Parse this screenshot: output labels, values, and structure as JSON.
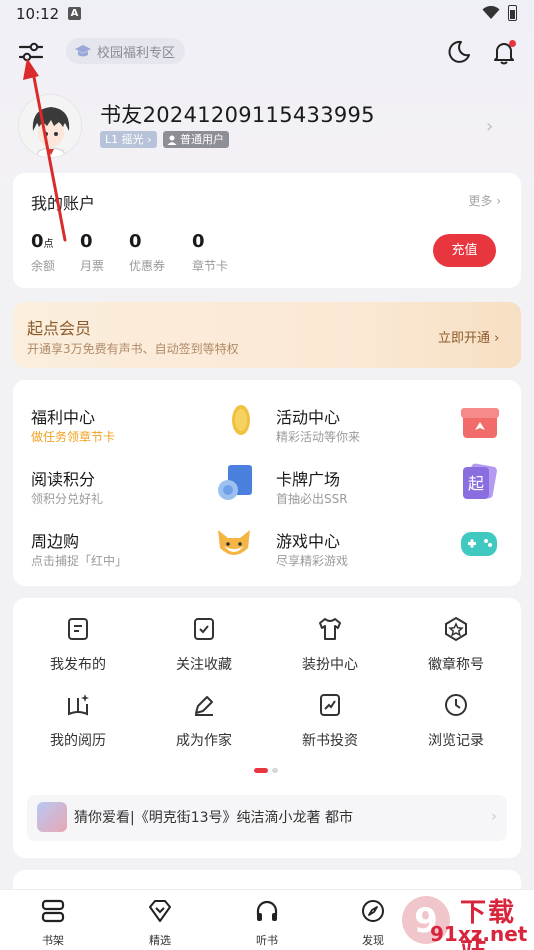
{
  "status_bar": {
    "time": "10:12",
    "notification_letter": "A"
  },
  "top_bar": {
    "campus_label": "校园福利专区",
    "filter_icon": "sliders-icon",
    "moon_icon": "moon-icon",
    "bell_icon": "bell-icon"
  },
  "profile": {
    "username": "书友20241209115433995",
    "level": "L1 摇光",
    "user_type": "普通用户"
  },
  "account": {
    "title": "我的账户",
    "more": "更多",
    "items": [
      {
        "value": "0",
        "unit": "点",
        "label": "余额"
      },
      {
        "value": "0",
        "unit": "",
        "label": "月票"
      },
      {
        "value": "0",
        "unit": "",
        "label": "优惠券"
      },
      {
        "value": "0",
        "unit": "",
        "label": "章节卡"
      }
    ],
    "recharge": "充值"
  },
  "vip": {
    "title": "起点会员",
    "desc": "开通享3万免费有声书、自动签到等特权",
    "open": "立即开通"
  },
  "services": [
    {
      "title": "福利中心",
      "sub": "做任务领章节卡",
      "icon": "gold-coin-icon",
      "sub_color": "#f0a020"
    },
    {
      "title": "活动中心",
      "sub": "精彩活动等你来",
      "icon": "gift-box-icon",
      "sub_color": "#9a9a9a"
    },
    {
      "title": "阅读积分",
      "sub": "领积分兑好礼",
      "icon": "points-book-icon",
      "sub_color": "#9a9a9a"
    },
    {
      "title": "卡牌广场",
      "sub": "首抽必出SSR",
      "icon": "card-icon",
      "sub_color": "#9a9a9a"
    },
    {
      "title": "周边购",
      "sub": "点击捕捉「红中」",
      "icon": "fox-mascot-icon",
      "sub_color": "#9a9a9a"
    },
    {
      "title": "游戏中心",
      "sub": "尽享精彩游戏",
      "icon": "gamepad-icon",
      "sub_color": "#9a9a9a"
    }
  ],
  "card_glyph": "起",
  "tools": [
    {
      "label": "我发布的",
      "icon": "document-icon"
    },
    {
      "label": "关注收藏",
      "icon": "bookmark-check-icon"
    },
    {
      "label": "装扮中心",
      "icon": "shirt-icon"
    },
    {
      "label": "徽章称号",
      "icon": "badge-star-icon"
    },
    {
      "label": "我的阅历",
      "icon": "reading-history-icon"
    },
    {
      "label": "成为作家",
      "icon": "pen-icon"
    },
    {
      "label": "新书投资",
      "icon": "trend-chart-icon"
    },
    {
      "label": "浏览记录",
      "icon": "clock-icon"
    }
  ],
  "guess": {
    "text": "猜你爱看|《明克街13号》纯洁滴小龙著 都市"
  },
  "bottom_nav": [
    {
      "label": "书架",
      "icon": "bookshelf-icon"
    },
    {
      "label": "精选",
      "icon": "diamond-icon"
    },
    {
      "label": "听书",
      "icon": "headphones-icon"
    },
    {
      "label": "发现",
      "icon": "compass-icon"
    }
  ],
  "watermark": {
    "site": "下载站",
    "url": "91xz.net"
  },
  "colors": {
    "accent": "#e8363f",
    "vip_text": "#8b5a2b",
    "welfare_sub": "#f0a020"
  }
}
